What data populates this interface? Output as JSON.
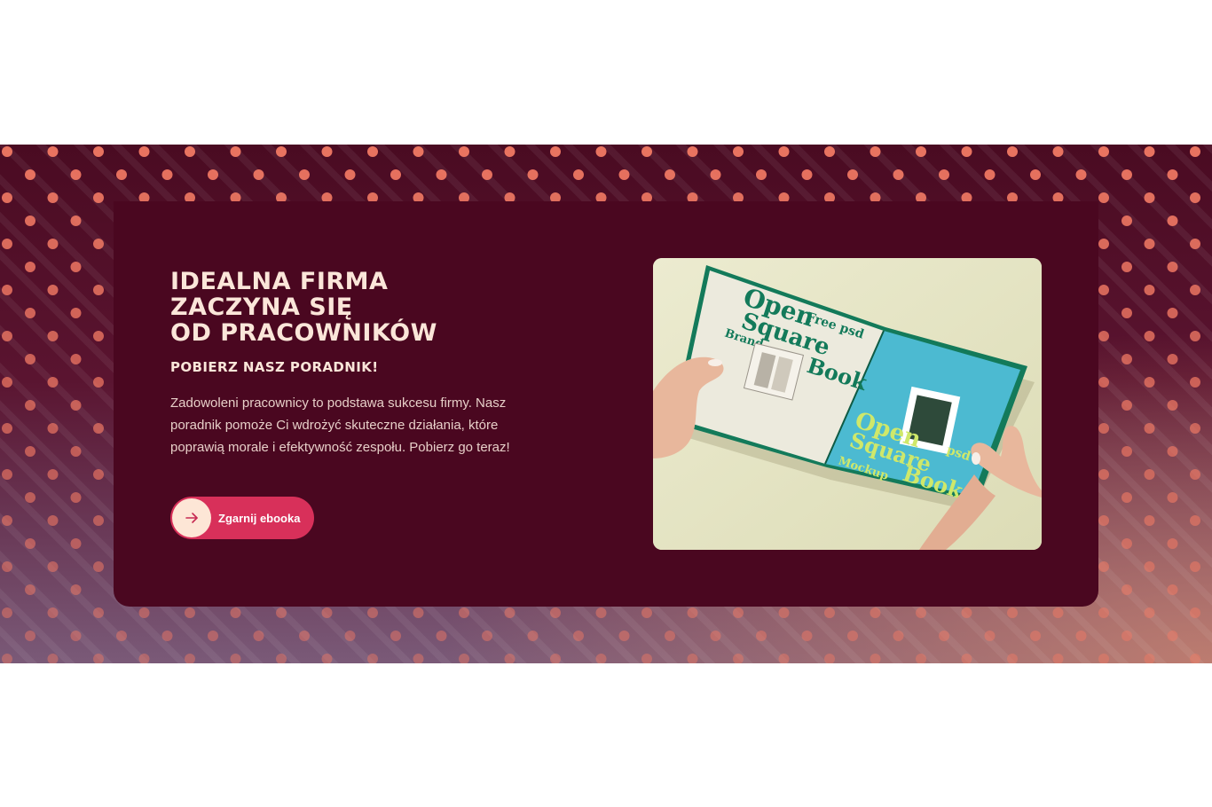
{
  "promo": {
    "headline_lines": [
      "IDEALNA FIRMA",
      "ZACZYNA SIĘ",
      "OD PRACOWNIKÓW"
    ],
    "subheadline": "POBIERZ NASZ PORADNIK!",
    "description": "Zadowoleni pracownicy to podstawa sukcesu firmy. Nasz poradnik pomoże Ci wdrożyć skuteczne działania, które poprawią morale i efektywność zespołu. Pobierz go teraz!",
    "cta_label": "Zgarnij ebooka",
    "cta_icon": "arrow-right-icon"
  },
  "book_mockup": {
    "cover_text_lines": [
      "Open",
      "Free psd",
      "Square",
      "Brand",
      "Book"
    ],
    "page_text_lines": [
      "Open",
      "Square",
      "psd",
      "Mockup",
      "Book"
    ]
  },
  "colors": {
    "card_background": "#4a0720",
    "headline": "#fbe6d9",
    "body_text": "#e7cfc8",
    "cta_background": "#d8305a",
    "cta_icon_background": "#fde6d6",
    "dot": "#f27a64"
  }
}
